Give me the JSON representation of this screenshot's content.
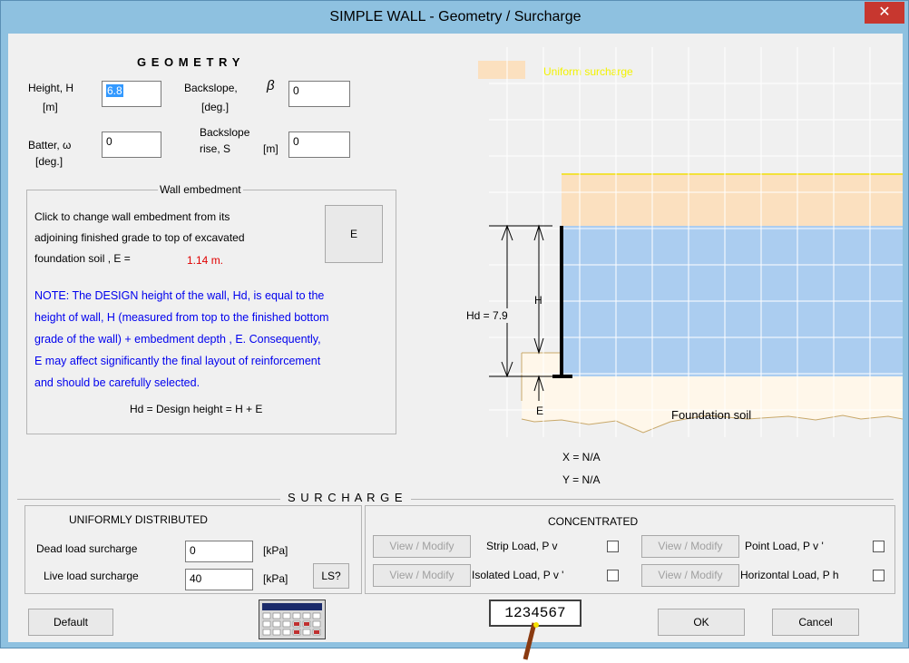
{
  "window": {
    "title": "SIMPLE WALL - Geometry / Surcharge",
    "close": "✕"
  },
  "geometry": {
    "heading": "G E O M E T R Y",
    "height_label_1": "Height, H",
    "height_label_2": "[m]",
    "height_value": "6.8",
    "batter_label_1": "Batter, ω",
    "batter_label_2": "[deg.]",
    "batter_value": "0",
    "backslope_label_1": "Backslope,",
    "backslope_symbol": "β",
    "backslope_label_2": "[deg.]",
    "backslope_value": "0",
    "rise_label_1": "Backslope",
    "rise_label_2": "rise, S",
    "rise_unit": "[m]",
    "rise_value": "0"
  },
  "embedment": {
    "title": "Wall embedment",
    "line1": "Click to change wall embedment from its",
    "line2": "adjoining finished grade to top of excavated",
    "line3": "foundation soil ,   E =",
    "value": "1.14 m.",
    "button": "E",
    "note1": "NOTE: The DESIGN height of the wall, Hd, is equal to the",
    "note2": "height of wall, H (measured from top to the finished bottom",
    "note3": "grade of the wall) + embedment depth , E.  Consequently,",
    "note4": "E may affect significantly the final layout of reinforcement",
    "note5": "and should be carefully selected.",
    "formula": "Hd = Design height = H + E"
  },
  "diagram": {
    "legend": "Uniform surcharge",
    "hd_label": "Hd = 7.9",
    "h_label": "H",
    "e_label": "E",
    "soil_label": "Foundation soil",
    "x_readout": "X = N/A",
    "y_readout": "Y = N/A",
    "colors": {
      "surcharge": "#fbe0bf",
      "backfill": "#abcdf0",
      "soil": "#fff7ea",
      "wall": "#000000",
      "grid": "#ffffff"
    }
  },
  "surcharge": {
    "heading": "S U R C H A R G E",
    "uniform_title": "UNIFORMLY   DISTRIBUTED",
    "dead_label": "Dead load surcharge",
    "dead_value": "0",
    "dead_unit": "[kPa]",
    "live_label": "Live load surcharge",
    "live_value": "40",
    "live_unit": "[kPa]",
    "ls_button": "LS?",
    "concentrated_title": "CONCENTRATED",
    "view_modify": "View / Modify",
    "strip_label": "Strip  Load,  P v",
    "isolated_label": "Isolated  Load,  P v '",
    "point_label": "Point  Load,    P v '",
    "horizontal_label": "Horizontal  Load,  P h"
  },
  "footer": {
    "default_button": "Default",
    "calculator_icon": "calculator-icon",
    "number_display": "1234567",
    "ok_button": "OK",
    "cancel_button": "Cancel"
  }
}
